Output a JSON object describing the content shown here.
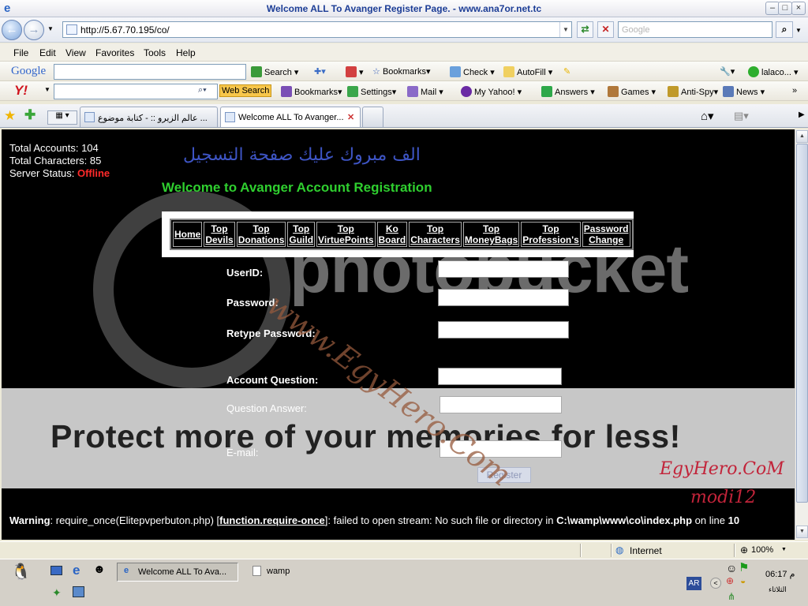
{
  "window": {
    "title": "Welcome ALL To Avanger Register Page. - www.ana7or.net.tc"
  },
  "address_bar": {
    "url": "http://5.67.70.195/co/",
    "search_placeholder": "Google"
  },
  "menu": [
    "File",
    "Edit",
    "View",
    "Favorites",
    "Tools",
    "Help"
  ],
  "google_toolbar": {
    "logo": "Google",
    "search": "Search",
    "bookmarks": "Bookmarks",
    "check": "Check",
    "autofill": "AutoFill",
    "user": "lalaco..."
  },
  "yahoo_toolbar": {
    "logo": "Y!",
    "web_search": "Web Search",
    "bookmarks": "Bookmarks",
    "settings": "Settings",
    "mail": "Mail",
    "my_yahoo": "My Yahoo!",
    "answers": "Answers",
    "games": "Games",
    "anti_spy": "Anti-Spy",
    "news": "News"
  },
  "tabs": [
    {
      "label": "عالم الزيرو :: - كتابة موضوع ..."
    },
    {
      "label": "Welcome ALL To Avanger..."
    }
  ],
  "page": {
    "stats": {
      "accounts_label": "Total Accounts: ",
      "accounts_value": "104",
      "characters_label": "Total Characters: ",
      "characters_value": "85",
      "server_label": "Server Status: ",
      "server_value": "Offline"
    },
    "arabic_heading": "الف مبروك عليك صفحة التسجيل",
    "welcome": "Welcome to Avanger Account Registration",
    "nav": [
      {
        "l1": "Home",
        "l2": ""
      },
      {
        "l1": "Top",
        "l2": "Devils"
      },
      {
        "l1": "Top",
        "l2": "Donations"
      },
      {
        "l1": "Top",
        "l2": "Guild"
      },
      {
        "l1": "Top",
        "l2": "VirtuePoints"
      },
      {
        "l1": "Ko",
        "l2": "Board"
      },
      {
        "l1": "Top",
        "l2": "Characters"
      },
      {
        "l1": "Top",
        "l2": "MoneyBags"
      },
      {
        "l1": "Top",
        "l2": "Profession's"
      },
      {
        "l1": "Password",
        "l2": "Change"
      }
    ],
    "form": {
      "userid": "UserID:",
      "password": "Password:",
      "retype": "Retype Password:",
      "question": "Account Question:",
      "answer": "Question Answer:",
      "email": "E-mail:",
      "register": "Register"
    },
    "warning": {
      "label": "Warning",
      "text1": ": require_once(Elitepvperbuton.php) [",
      "link": "function.require-once",
      "text2": "]: failed to open stream: No such file or directory in ",
      "path": "C:\\wamp\\www\\co\\index.php",
      "text3": " on line ",
      "line": "10"
    }
  },
  "watermark": {
    "photobucket": "photobucket",
    "protect": "Protect more of your memories for less!",
    "egyhero_diag": "www.EgyHero.Com",
    "egyhero_sig": "EgyHero.CoM",
    "modi": "modi12"
  },
  "status_bar": {
    "zone": "Internet",
    "zoom": "100%"
  },
  "taskbar": {
    "ie_task": "Welcome ALL To Ava...",
    "wamp_task": "wamp",
    "lang": "AR",
    "time": "06:17",
    "ampm": "م",
    "day": "الثلاثاء"
  },
  "colors": {
    "title_text": "#1c3d96",
    "welcome_green": "#2fcf2f",
    "offline_red": "#ff2a2a",
    "arabic_blue": "#3e55c5"
  }
}
